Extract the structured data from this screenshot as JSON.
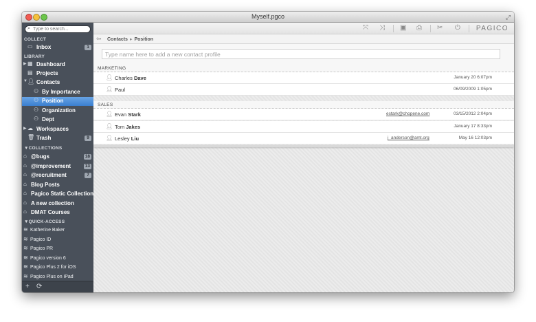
{
  "window": {
    "title": "Myself.pgco"
  },
  "sidebar": {
    "search_placeholder": "Type to search...",
    "sections": {
      "collect": "COLLECT",
      "library": "LIBRARY",
      "collections": "COLLECTIONS",
      "quick_access": "QUICK-ACCESS"
    },
    "collect_items": [
      {
        "label": "Inbox",
        "badge": "1",
        "icon": "inbox-icon"
      }
    ],
    "library_items": [
      {
        "label": "Dashboard",
        "icon": "dashboard-icon"
      },
      {
        "label": "Projects",
        "icon": "projects-icon"
      },
      {
        "label": "Contacts",
        "icon": "contacts-icon"
      },
      {
        "label": "By Importance",
        "icon": "contacts-icon"
      },
      {
        "label": "Position",
        "icon": "contacts-icon",
        "selected": true
      },
      {
        "label": "Organization",
        "icon": "contacts-icon"
      },
      {
        "label": "Dept",
        "icon": "contacts-icon"
      },
      {
        "label": "Workspaces",
        "icon": "cloud-icon"
      },
      {
        "label": "Trash",
        "icon": "trash-icon",
        "badge": "9"
      }
    ],
    "collections": [
      {
        "label": "@bugs",
        "badge": "18"
      },
      {
        "label": "@improvement",
        "badge": "13"
      },
      {
        "label": "@recruitment",
        "badge": "7"
      },
      {
        "label": "Blog Posts"
      },
      {
        "label": "Pagico Static Collection"
      },
      {
        "label": "A new collection"
      },
      {
        "label": "DMAT Courses"
      }
    ],
    "quick_access": [
      "Katherine Baker",
      "Pagico ID",
      "Pagico PR",
      "Pagico version 6",
      "Pagico Plus 2 for iOS",
      "Pagico Plus on iPad"
    ]
  },
  "toolbar": {
    "brand": "PAGICO",
    "icons": [
      "expand-icon",
      "collapse-icon",
      "archive-icon",
      "print-icon",
      "tools-icon",
      "power-icon"
    ]
  },
  "breadcrumb": {
    "parent": "Contacts",
    "current": "Position"
  },
  "add_contact_placeholder": "Type name here to add a new contact profile",
  "groups": [
    {
      "title": "MARKETING",
      "contacts": [
        {
          "first": "Charles",
          "last": "Dave",
          "email": "",
          "date": "January 20 6:07pm"
        },
        {
          "first": "Paul",
          "last": "",
          "email": "",
          "date": "06/09/2009 1:05pm"
        }
      ]
    },
    {
      "title": "SALES",
      "contacts": [
        {
          "first": "Evan",
          "last": "Stark",
          "email": "estark@chopene.com",
          "date": "03/15/2012 2:04pm"
        },
        {
          "first": "Tom",
          "last": "Jakes",
          "email": "",
          "date": "January 17 8:33pm"
        },
        {
          "first": "Lesley",
          "last": "Liu",
          "email": "j_anderson@amt.org",
          "date": "May 16 12:03pm"
        }
      ]
    }
  ]
}
